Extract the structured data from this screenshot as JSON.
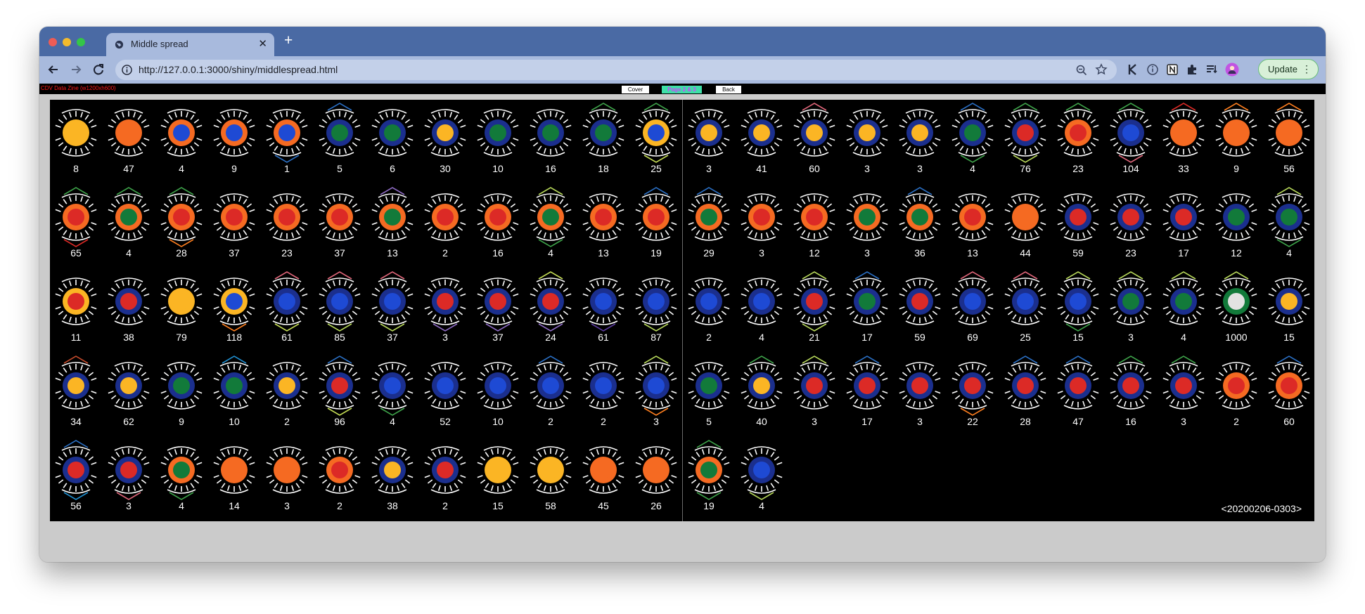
{
  "window": {
    "tab_title": "Middle spread",
    "url": "http://127.0.0.1:3000/shiny/middlespread.html",
    "update_label": "Update"
  },
  "icons": {
    "tab": "globe-icon",
    "new_tab": "plus-icon",
    "back": "back-arrow-icon",
    "forward": "forward-arrow-icon",
    "reload": "reload-icon",
    "info": "info-icon",
    "zoom": "zoom-icon",
    "bookmark": "star-icon",
    "extensions": [
      "k-extension-icon",
      "info-extension-icon",
      "notion-icon",
      "puzzle-icon",
      "reading-list-icon",
      "profile-avatar-icon"
    ],
    "more": "more-vertical-icon"
  },
  "zine": {
    "label": "CDV Data Zine (w1200xh600)",
    "nav": [
      "Cover",
      "Page 2 & 3",
      "Back"
    ],
    "footer_id": "<20200206-0303>"
  },
  "colors": {
    "chrome_tab_bar": "#4a6aa4",
    "chrome_toolbar": "#a8badd",
    "page_background": "#000000",
    "zine_label": "#ff1a1a",
    "page_button_bg": "#3ee0a8",
    "page_button_text": "#d23cff",
    "palette": {
      "n": "#1b2f8e",
      "o": "#f56a22",
      "y": "#fbb524",
      "r": "#dc2a26",
      "b": "#1e4ad4",
      "g": "#127a3a",
      "w": "#e2e2e2",
      "ln": "#ff7f1f",
      "lo": "#c44a2b",
      "lb": "#2a6fc4",
      "lg": "#3ea34a",
      "ly": "#c5dd55",
      "lp": "#e0667a",
      "lv": "#8e6bc4",
      "lc": "#1f8fd0",
      "ld": "#5b3a9e",
      "lh": "#b7d85a"
    }
  },
  "left_page": [
    {
      "n": "8",
      "ring": "y",
      "core": "y",
      "top": "",
      "bot": ""
    },
    {
      "n": "47",
      "ring": "o",
      "core": "o",
      "top": "",
      "bot": ""
    },
    {
      "n": "4",
      "ring": "o",
      "core": "b",
      "top": "",
      "bot": ""
    },
    {
      "n": "9",
      "ring": "o",
      "core": "b",
      "top": "",
      "bot": ""
    },
    {
      "n": "1",
      "ring": "o",
      "core": "b",
      "top": "",
      "bot": "lb"
    },
    {
      "n": "5",
      "ring": "n",
      "core": "g",
      "top": "lb",
      "bot": ""
    },
    {
      "n": "6",
      "ring": "n",
      "core": "g",
      "top": "",
      "bot": ""
    },
    {
      "n": "30",
      "ring": "n",
      "core": "y",
      "top": "",
      "bot": ""
    },
    {
      "n": "10",
      "ring": "n",
      "core": "g",
      "top": "",
      "bot": ""
    },
    {
      "n": "16",
      "ring": "n",
      "core": "g",
      "top": "",
      "bot": ""
    },
    {
      "n": "18",
      "ring": "n",
      "core": "g",
      "top": "lg",
      "bot": ""
    },
    {
      "n": "25",
      "ring": "y",
      "core": "b",
      "top": "lg",
      "bot": "ly"
    },
    {
      "n": "65",
      "ring": "o",
      "core": "r",
      "top": "lg",
      "bot": "r"
    },
    {
      "n": "4",
      "ring": "o",
      "core": "g",
      "top": "lg",
      "bot": ""
    },
    {
      "n": "28",
      "ring": "o",
      "core": "r",
      "top": "lg",
      "bot": "ln"
    },
    {
      "n": "37",
      "ring": "o",
      "core": "r",
      "top": "",
      "bot": ""
    },
    {
      "n": "23",
      "ring": "o",
      "core": "r",
      "top": "",
      "bot": ""
    },
    {
      "n": "37",
      "ring": "o",
      "core": "r",
      "top": "",
      "bot": ""
    },
    {
      "n": "13",
      "ring": "o",
      "core": "g",
      "top": "lv",
      "bot": ""
    },
    {
      "n": "2",
      "ring": "o",
      "core": "r",
      "top": "",
      "bot": ""
    },
    {
      "n": "16",
      "ring": "o",
      "core": "r",
      "top": "",
      "bot": ""
    },
    {
      "n": "4",
      "ring": "o",
      "core": "g",
      "top": "lh",
      "bot": "lg"
    },
    {
      "n": "13",
      "ring": "o",
      "core": "r",
      "top": "",
      "bot": ""
    },
    {
      "n": "19",
      "ring": "o",
      "core": "r",
      "top": "lb",
      "bot": ""
    },
    {
      "n": "11",
      "ring": "y",
      "core": "r",
      "top": "",
      "bot": ""
    },
    {
      "n": "38",
      "ring": "n",
      "core": "r",
      "top": "",
      "bot": ""
    },
    {
      "n": "79",
      "ring": "y",
      "core": "y",
      "top": "",
      "bot": ""
    },
    {
      "n": "118",
      "ring": "y",
      "core": "b",
      "top": "",
      "bot": "ln"
    },
    {
      "n": "61",
      "ring": "n",
      "core": "b",
      "top": "lp",
      "bot": "ly"
    },
    {
      "n": "85",
      "ring": "n",
      "core": "b",
      "top": "lp",
      "bot": "lh"
    },
    {
      "n": "37",
      "ring": "n",
      "core": "b",
      "top": "lp",
      "bot": "lh"
    },
    {
      "n": "3",
      "ring": "n",
      "core": "r",
      "top": "",
      "bot": "lv"
    },
    {
      "n": "37",
      "ring": "n",
      "core": "r",
      "top": "",
      "bot": "lv"
    },
    {
      "n": "24",
      "ring": "n",
      "core": "r",
      "top": "ly",
      "bot": "lv"
    },
    {
      "n": "61",
      "ring": "n",
      "core": "b",
      "top": "",
      "bot": "ld"
    },
    {
      "n": "87",
      "ring": "n",
      "core": "b",
      "top": "",
      "bot": "lh"
    },
    {
      "n": "34",
      "ring": "n",
      "core": "y",
      "top": "lo",
      "bot": ""
    },
    {
      "n": "62",
      "ring": "n",
      "core": "y",
      "top": "",
      "bot": ""
    },
    {
      "n": "9",
      "ring": "n",
      "core": "g",
      "top": "",
      "bot": ""
    },
    {
      "n": "10",
      "ring": "n",
      "core": "g",
      "top": "lc",
      "bot": ""
    },
    {
      "n": "2",
      "ring": "n",
      "core": "y",
      "top": "",
      "bot": ""
    },
    {
      "n": "96",
      "ring": "n",
      "core": "r",
      "top": "lb",
      "bot": "ly"
    },
    {
      "n": "4",
      "ring": "n",
      "core": "b",
      "top": "",
      "bot": "lg"
    },
    {
      "n": "52",
      "ring": "n",
      "core": "b",
      "top": "",
      "bot": ""
    },
    {
      "n": "10",
      "ring": "n",
      "core": "b",
      "top": "",
      "bot": ""
    },
    {
      "n": "2",
      "ring": "n",
      "core": "b",
      "top": "lb",
      "bot": ""
    },
    {
      "n": "2",
      "ring": "n",
      "core": "b",
      "top": "",
      "bot": ""
    },
    {
      "n": "3",
      "ring": "n",
      "core": "b",
      "top": "lh",
      "bot": "ln"
    },
    {
      "n": "56",
      "ring": "n",
      "core": "r",
      "top": "lb",
      "bot": "lc"
    },
    {
      "n": "3",
      "ring": "n",
      "core": "r",
      "top": "",
      "bot": "lp"
    },
    {
      "n": "4",
      "ring": "o",
      "core": "g",
      "top": "",
      "bot": "lg"
    },
    {
      "n": "14",
      "ring": "o",
      "core": "o",
      "top": "",
      "bot": ""
    },
    {
      "n": "3",
      "ring": "o",
      "core": "o",
      "top": "",
      "bot": ""
    },
    {
      "n": "2",
      "ring": "o",
      "core": "r",
      "top": "",
      "bot": ""
    },
    {
      "n": "38",
      "ring": "n",
      "core": "y",
      "top": "",
      "bot": ""
    },
    {
      "n": "2",
      "ring": "n",
      "core": "r",
      "top": "",
      "bot": ""
    },
    {
      "n": "15",
      "ring": "y",
      "core": "y",
      "top": "",
      "bot": ""
    },
    {
      "n": "58",
      "ring": "y",
      "core": "y",
      "top": "",
      "bot": ""
    },
    {
      "n": "45",
      "ring": "o",
      "core": "o",
      "top": "",
      "bot": ""
    },
    {
      "n": "26",
      "ring": "o",
      "core": "o",
      "top": "",
      "bot": ""
    }
  ],
  "right_page": [
    {
      "n": "3",
      "ring": "n",
      "core": "y",
      "top": "",
      "bot": ""
    },
    {
      "n": "41",
      "ring": "n",
      "core": "y",
      "top": "",
      "bot": ""
    },
    {
      "n": "60",
      "ring": "n",
      "core": "y",
      "top": "lp",
      "bot": ""
    },
    {
      "n": "3",
      "ring": "n",
      "core": "y",
      "top": "",
      "bot": ""
    },
    {
      "n": "3",
      "ring": "n",
      "core": "y",
      "top": "",
      "bot": ""
    },
    {
      "n": "4",
      "ring": "n",
      "core": "g",
      "top": "lb",
      "bot": "lg"
    },
    {
      "n": "76",
      "ring": "n",
      "core": "r",
      "top": "lg",
      "bot": "lh"
    },
    {
      "n": "23",
      "ring": "o",
      "core": "r",
      "top": "lg",
      "bot": ""
    },
    {
      "n": "104",
      "ring": "n",
      "core": "b",
      "top": "lg",
      "bot": "lp"
    },
    {
      "n": "33",
      "ring": "o",
      "core": "o",
      "top": "r",
      "bot": ""
    },
    {
      "n": "9",
      "ring": "o",
      "core": "o",
      "top": "ln",
      "bot": ""
    },
    {
      "n": "56",
      "ring": "o",
      "core": "o",
      "top": "ln",
      "bot": ""
    },
    {
      "n": "29",
      "ring": "o",
      "core": "g",
      "top": "lb",
      "bot": ""
    },
    {
      "n": "3",
      "ring": "o",
      "core": "r",
      "top": "",
      "bot": ""
    },
    {
      "n": "12",
      "ring": "o",
      "core": "r",
      "top": "",
      "bot": ""
    },
    {
      "n": "3",
      "ring": "o",
      "core": "g",
      "top": "",
      "bot": ""
    },
    {
      "n": "36",
      "ring": "o",
      "core": "g",
      "top": "lb",
      "bot": ""
    },
    {
      "n": "13",
      "ring": "o",
      "core": "r",
      "top": "",
      "bot": ""
    },
    {
      "n": "44",
      "ring": "o",
      "core": "o",
      "top": "",
      "bot": ""
    },
    {
      "n": "59",
      "ring": "n",
      "core": "r",
      "top": "",
      "bot": ""
    },
    {
      "n": "23",
      "ring": "n",
      "core": "r",
      "top": "",
      "bot": ""
    },
    {
      "n": "17",
      "ring": "n",
      "core": "r",
      "top": "",
      "bot": ""
    },
    {
      "n": "12",
      "ring": "n",
      "core": "g",
      "top": "",
      "bot": ""
    },
    {
      "n": "4",
      "ring": "n",
      "core": "g",
      "top": "lh",
      "bot": "lg"
    },
    {
      "n": "2",
      "ring": "n",
      "core": "b",
      "top": "",
      "bot": ""
    },
    {
      "n": "4",
      "ring": "n",
      "core": "b",
      "top": "",
      "bot": ""
    },
    {
      "n": "21",
      "ring": "n",
      "core": "r",
      "top": "lh",
      "bot": "lh"
    },
    {
      "n": "17",
      "ring": "n",
      "core": "g",
      "top": "lb",
      "bot": ""
    },
    {
      "n": "59",
      "ring": "n",
      "core": "r",
      "top": "",
      "bot": ""
    },
    {
      "n": "69",
      "ring": "n",
      "core": "b",
      "top": "lp",
      "bot": ""
    },
    {
      "n": "25",
      "ring": "n",
      "core": "b",
      "top": "lp",
      "bot": ""
    },
    {
      "n": "15",
      "ring": "n",
      "core": "b",
      "top": "lh",
      "bot": "lg"
    },
    {
      "n": "3",
      "ring": "n",
      "core": "g",
      "top": "lh",
      "bot": ""
    },
    {
      "n": "4",
      "ring": "n",
      "core": "g",
      "top": "lh",
      "bot": ""
    },
    {
      "n": "1000",
      "ring": "g",
      "core": "w",
      "top": "lh",
      "bot": ""
    },
    {
      "n": "15",
      "ring": "n",
      "core": "y",
      "top": "",
      "bot": ""
    },
    {
      "n": "5",
      "ring": "n",
      "core": "g",
      "top": "",
      "bot": ""
    },
    {
      "n": "40",
      "ring": "n",
      "core": "y",
      "top": "lg",
      "bot": ""
    },
    {
      "n": "3",
      "ring": "n",
      "core": "r",
      "top": "lh",
      "bot": ""
    },
    {
      "n": "17",
      "ring": "n",
      "core": "r",
      "top": "lb",
      "bot": ""
    },
    {
      "n": "3",
      "ring": "n",
      "core": "r",
      "top": "",
      "bot": ""
    },
    {
      "n": "22",
      "ring": "n",
      "core": "r",
      "top": "",
      "bot": "ln"
    },
    {
      "n": "28",
      "ring": "n",
      "core": "r",
      "top": "lb",
      "bot": ""
    },
    {
      "n": "47",
      "ring": "n",
      "core": "r",
      "top": "lb",
      "bot": ""
    },
    {
      "n": "16",
      "ring": "n",
      "core": "r",
      "top": "lg",
      "bot": ""
    },
    {
      "n": "3",
      "ring": "n",
      "core": "r",
      "top": "lg",
      "bot": ""
    },
    {
      "n": "2",
      "ring": "o",
      "core": "r",
      "top": "",
      "bot": ""
    },
    {
      "n": "60",
      "ring": "o",
      "core": "r",
      "top": "lb",
      "bot": ""
    },
    {
      "n": "19",
      "ring": "o",
      "core": "g",
      "top": "lg",
      "bot": "lg"
    },
    {
      "n": "4",
      "ring": "n",
      "core": "b",
      "top": "",
      "bot": "lh"
    }
  ]
}
